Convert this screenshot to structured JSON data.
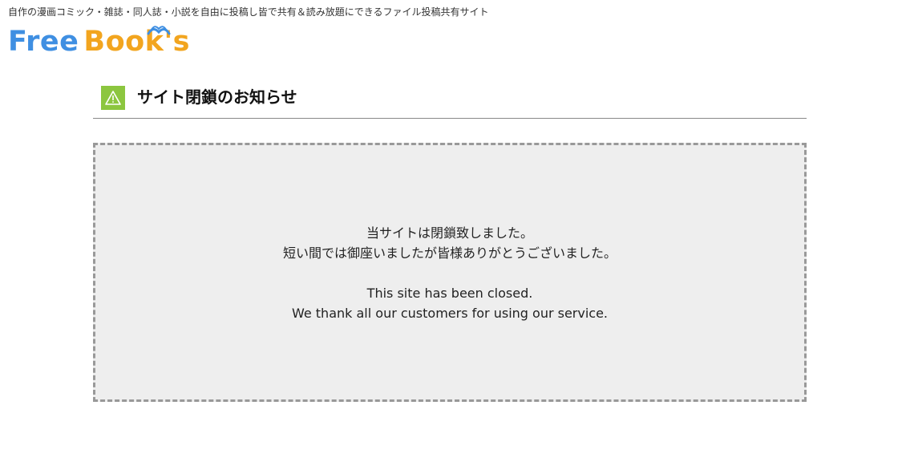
{
  "header": {
    "tagline": "自作の漫画コミック・雑誌・同人誌・小説を自由に投稿し皆で共有＆読み放題にできるファイル投稿共有サイト",
    "logo_free": "Free",
    "logo_books": "Book's"
  },
  "notice": {
    "heading": "サイト閉鎖のお知らせ",
    "jp_line1": "当サイトは閉鎖致しました。",
    "jp_line2": "短い間では御座いましたが皆様ありがとうございました。",
    "en_line1": "This site has been closed.",
    "en_line2": "We thank all our customers for using our service."
  },
  "colors": {
    "logo_free": "#3f8fe2",
    "logo_books": "#f2a51f",
    "warning_badge": "#8cc63f",
    "notice_bg": "#eeeeee",
    "notice_border": "#999999"
  },
  "icons": {
    "heading_icon": "warning-icon",
    "logo_icon": "open-book-icon"
  }
}
